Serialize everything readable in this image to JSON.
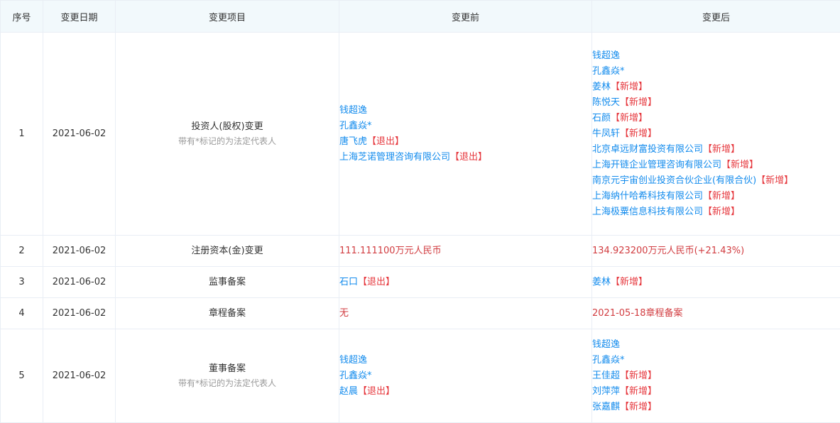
{
  "table": {
    "headers": [
      "序号",
      "变更日期",
      "变更项目",
      "变更前",
      "变更后"
    ],
    "rows": [
      {
        "index": "1",
        "date": "2021-06-02",
        "item": "投资人(股权)变更",
        "note": "带有*标记的为法定代表人",
        "before": [
          {
            "name": "钱超逸",
            "tag": ""
          },
          {
            "name": "孔鑫焱*",
            "tag": ""
          },
          {
            "name": "唐飞虎",
            "tag": "【退出】"
          },
          {
            "name": "上海芝诺管理咨询有限公司",
            "tag": "【退出】"
          }
        ],
        "after": [
          {
            "name": "钱超逸",
            "tag": ""
          },
          {
            "name": "孔鑫焱*",
            "tag": ""
          },
          {
            "name": "姜林",
            "tag": "【新增】"
          },
          {
            "name": "陈悦天",
            "tag": "【新增】"
          },
          {
            "name": "石颜",
            "tag": "【新增】"
          },
          {
            "name": "牛凤轩",
            "tag": "【新增】"
          },
          {
            "name": "北京卓远财富投资有限公司",
            "tag": "【新增】"
          },
          {
            "name": "上海开链企业管理咨询有限公司",
            "tag": "【新增】"
          },
          {
            "name": "南京元宇宙创业投资合伙企业(有限合伙)",
            "tag": "【新增】"
          },
          {
            "name": "上海纳什哈希科技有限公司",
            "tag": "【新增】"
          },
          {
            "name": "上海极粟信息科技有限公司",
            "tag": "【新增】"
          }
        ]
      },
      {
        "index": "2",
        "date": "2021-06-02",
        "item": "注册资本(金)变更",
        "before_text": "111.111100万元人民币",
        "after_text": "134.923200万元人民币(+21.43%)"
      },
      {
        "index": "3",
        "date": "2021-06-02",
        "item": "监事备案",
        "before": [
          {
            "name": "石口",
            "tag": "【退出】"
          }
        ],
        "after": [
          {
            "name": "姜林",
            "tag": "【新增】"
          }
        ]
      },
      {
        "index": "4",
        "date": "2021-06-02",
        "item": "章程备案",
        "before_text": "无",
        "after_text": "2021-05-18章程备案"
      },
      {
        "index": "5",
        "date": "2021-06-02",
        "item": "董事备案",
        "note": "带有*标记的为法定代表人",
        "before": [
          {
            "name": "钱超逸",
            "tag": ""
          },
          {
            "name": "孔鑫焱*",
            "tag": ""
          },
          {
            "name": "赵晨",
            "tag": "【退出】"
          }
        ],
        "after": [
          {
            "name": "钱超逸",
            "tag": ""
          },
          {
            "name": "孔鑫焱*",
            "tag": ""
          },
          {
            "name": "王佳超",
            "tag": "【新增】"
          },
          {
            "name": "刘萍萍",
            "tag": "【新增】"
          },
          {
            "name": "张嘉麒",
            "tag": "【新增】"
          }
        ]
      }
    ]
  },
  "colors": {
    "link": "#128bed",
    "tag": "#e6383e",
    "header_bg": "#f2f9fc",
    "border": "#e9eef5"
  }
}
